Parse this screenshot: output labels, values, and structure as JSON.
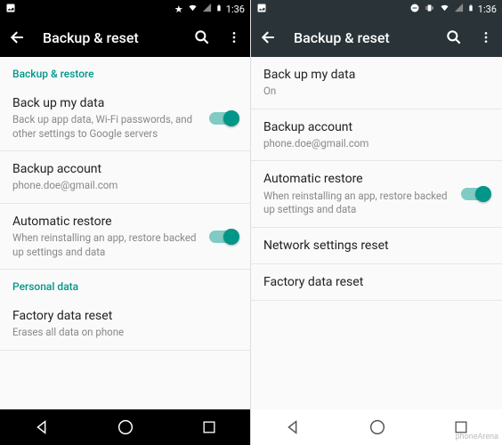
{
  "left": {
    "status": {
      "time": "1:36"
    },
    "app_bar": {
      "title": "Backup & reset"
    },
    "sections": {
      "backup_restore": {
        "header": "Backup & restore",
        "backup_data": {
          "title": "Back up my data",
          "subtitle": "Back up app data, Wi-Fi passwords, and other settings to Google servers",
          "on": true
        },
        "backup_account": {
          "title": "Backup account",
          "subtitle": "phone.doe@gmail.com"
        },
        "auto_restore": {
          "title": "Automatic restore",
          "subtitle": "When reinstalling an app, restore backed up settings and data",
          "on": true
        }
      },
      "personal_data": {
        "header": "Personal data",
        "factory_reset": {
          "title": "Factory data reset",
          "subtitle": "Erases all data on phone"
        }
      }
    }
  },
  "right": {
    "status": {
      "time": "1:36"
    },
    "app_bar": {
      "title": "Backup & reset"
    },
    "items": {
      "backup_data": {
        "title": "Back up my data",
        "subtitle": "On"
      },
      "backup_account": {
        "title": "Backup account",
        "subtitle": "phone.doe@gmail.com"
      },
      "auto_restore": {
        "title": "Automatic restore",
        "subtitle": "When reinstalling an app, restore backed up settings and data",
        "on": true
      },
      "network_reset": {
        "title": "Network settings reset"
      },
      "factory_reset": {
        "title": "Factory data reset"
      }
    }
  },
  "watermark": "phoneArena"
}
